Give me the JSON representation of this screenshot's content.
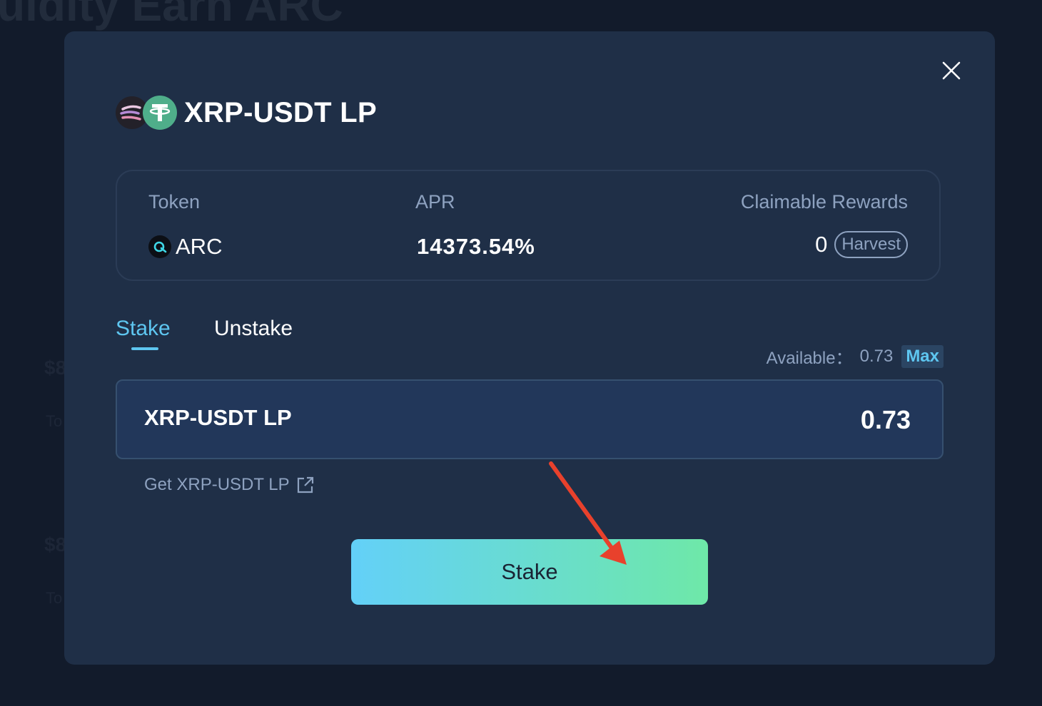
{
  "background": {
    "page_heading": "uidity Earn ARC",
    "faint_values": [
      "$8",
      "To",
      "$8",
      "To"
    ]
  },
  "modal": {
    "title": "XRP-USDT LP",
    "close_icon": "close-icon",
    "pair_icons": [
      "xrp-token-icon",
      "usdt-token-icon"
    ],
    "info": {
      "token_label": "Token",
      "token_value": "ARC",
      "apr_label": "APR",
      "apr_value": "14373.54%",
      "rewards_label": "Claimable Rewards",
      "rewards_value": "0",
      "harvest_label": "Harvest"
    },
    "tabs": [
      {
        "label": "Stake",
        "active": true
      },
      {
        "label": "Unstake",
        "active": false
      }
    ],
    "available_label": "Available：",
    "available_value": "0.73",
    "max_label": "Max",
    "input": {
      "token": "XRP-USDT LP",
      "value": "0.73"
    },
    "get_link": "Get XRP-USDT LP",
    "stake_button": "Stake"
  },
  "colors": {
    "modal_bg": "#1f2f47",
    "accent": "#5ec6f0",
    "button_gradient_start": "#63d0f8",
    "button_gradient_end": "#6ee8a8",
    "annotation_arrow": "#e8412c"
  }
}
